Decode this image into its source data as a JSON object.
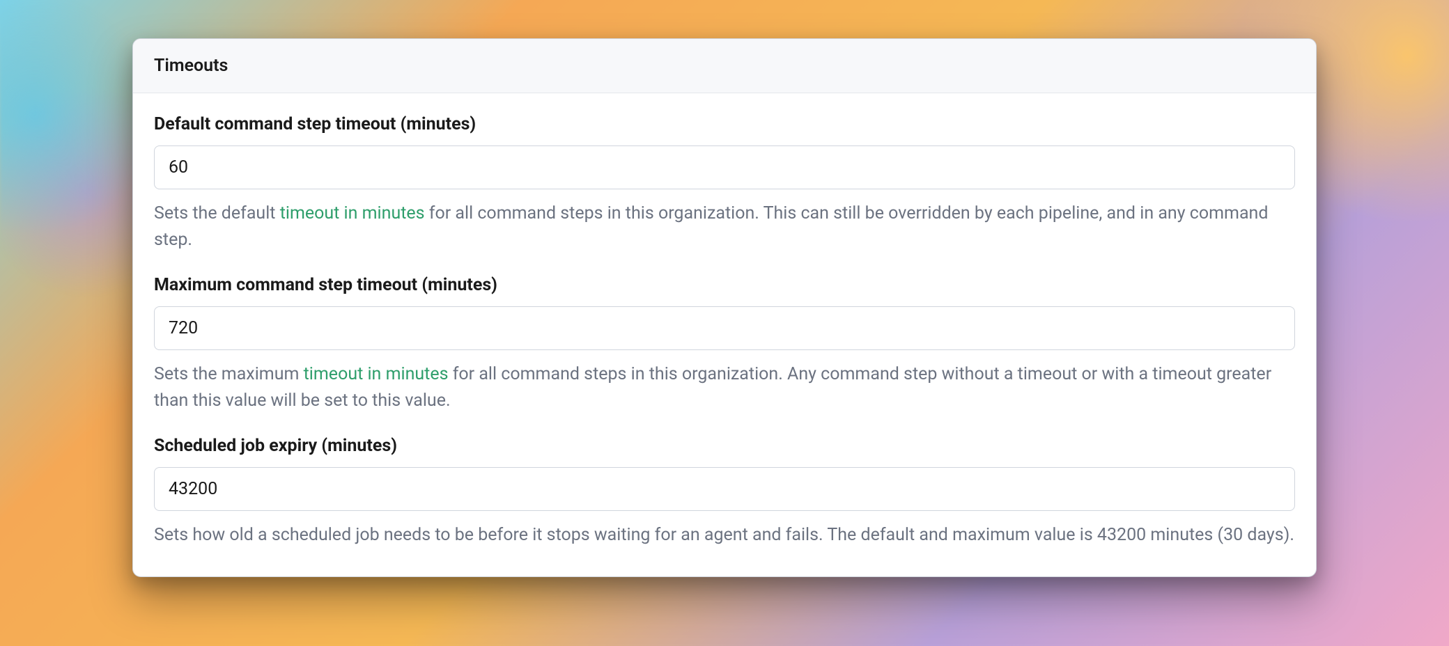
{
  "panel": {
    "title": "Timeouts",
    "fields": {
      "default_timeout": {
        "label": "Default command step timeout (minutes)",
        "value": "60",
        "help_before": "Sets the default ",
        "help_link": "timeout in minutes",
        "help_after": " for all command steps in this organization. This can still be overridden by each pipeline, and in any command step."
      },
      "max_timeout": {
        "label": "Maximum command step timeout (minutes)",
        "value": "720",
        "help_before": "Sets the maximum ",
        "help_link": "timeout in minutes",
        "help_after": " for all command steps in this organization. Any command step without a timeout or with a timeout greater than this value will be set to this value."
      },
      "job_expiry": {
        "label": "Scheduled job expiry (minutes)",
        "value": "43200",
        "help_text": "Sets how old a scheduled job needs to be before it stops waiting for an agent and fails. The default and maximum value is 43200 minutes (30 days)."
      }
    }
  }
}
